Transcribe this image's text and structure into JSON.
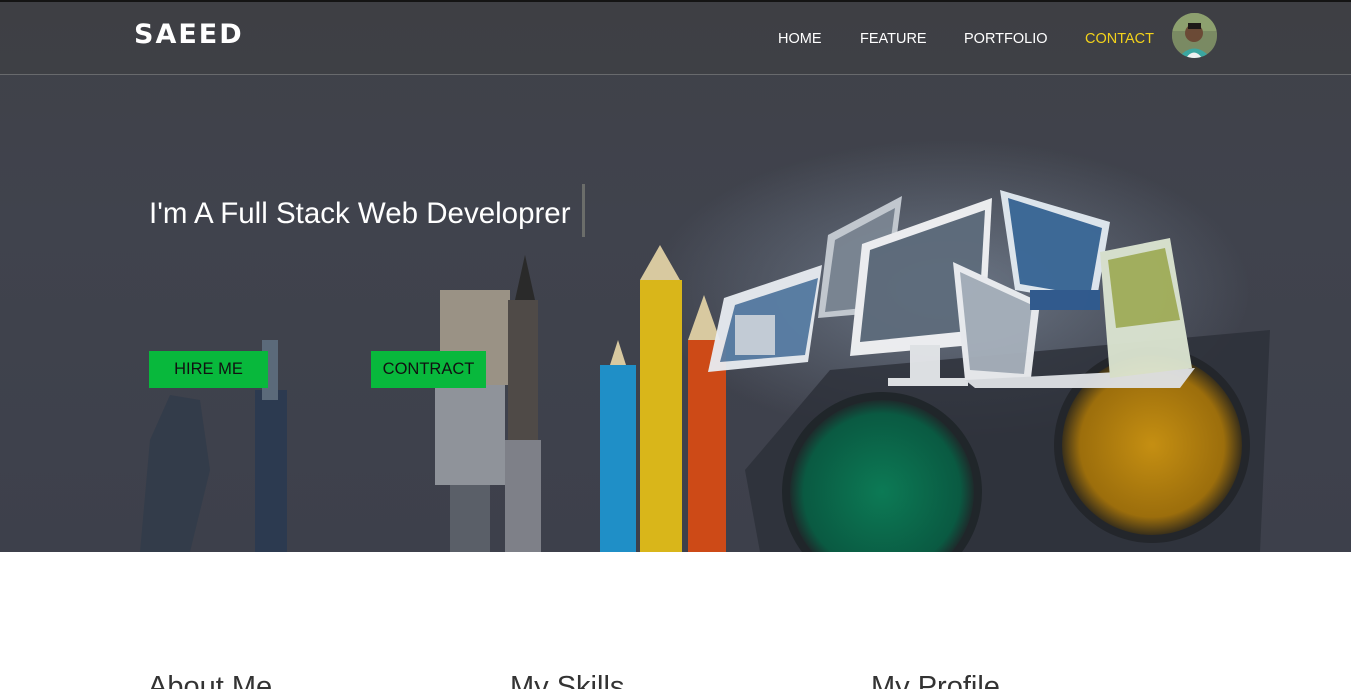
{
  "brand": {
    "name": "SAEED"
  },
  "nav": {
    "items": [
      {
        "label": "HOME",
        "active": false
      },
      {
        "label": "FEATURE",
        "active": false
      },
      {
        "label": "PORTFOLIO",
        "active": false
      },
      {
        "label": "CONTACT",
        "active": true
      }
    ],
    "active_color": "#f2d21b"
  },
  "hero": {
    "headline": "I'm A Full Stack Web Developrer",
    "buttons": {
      "hire": "HIRE ME",
      "contract": "CONTRACT"
    },
    "button_color": "#08b83c",
    "illustration": "desk-with-pencils-brushes-paint-and-website-mockups"
  },
  "sections": {
    "about": "About Me",
    "skills": "My Skills",
    "profile": "My Profile"
  }
}
